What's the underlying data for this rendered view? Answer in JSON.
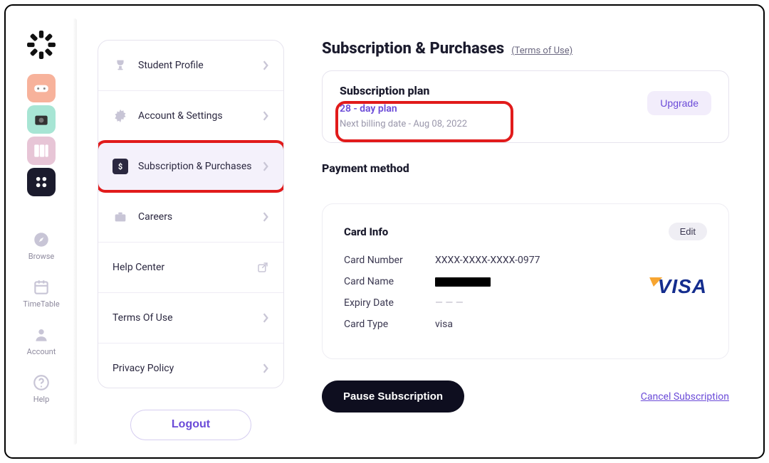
{
  "rail": {
    "nav": [
      {
        "label": "Browse"
      },
      {
        "label": "TimeTable"
      },
      {
        "label": "Account"
      },
      {
        "label": "Help"
      }
    ]
  },
  "settings": {
    "items": [
      {
        "label": "Student Profile"
      },
      {
        "label": "Account & Settings"
      },
      {
        "label": "Subscription & Purchases"
      },
      {
        "label": "Careers"
      },
      {
        "label": "Help Center"
      },
      {
        "label": "Terms Of Use"
      },
      {
        "label": "Privacy Policy"
      }
    ],
    "logout": "Logout"
  },
  "page": {
    "title": "Subscription & Purchases",
    "terms_link": "(Terms of Use)",
    "plan_section": "Subscription plan",
    "plan_name": "28 - day plan",
    "plan_next_billing": "Next billing date - Aug 08, 2022",
    "upgrade": "Upgrade",
    "payment_section": "Payment method",
    "card_info_title": "Card Info",
    "edit": "Edit",
    "fields": {
      "number_label": "Card Number",
      "number_value": "XXXX-XXXX-XXXX-0977",
      "name_label": "Card Name",
      "expiry_label": "Expiry Date",
      "expiry_value": "— — —",
      "type_label": "Card Type",
      "type_value": "visa"
    },
    "brand": "VISA",
    "pause": "Pause Subscription",
    "cancel": "Cancel Subscription"
  }
}
